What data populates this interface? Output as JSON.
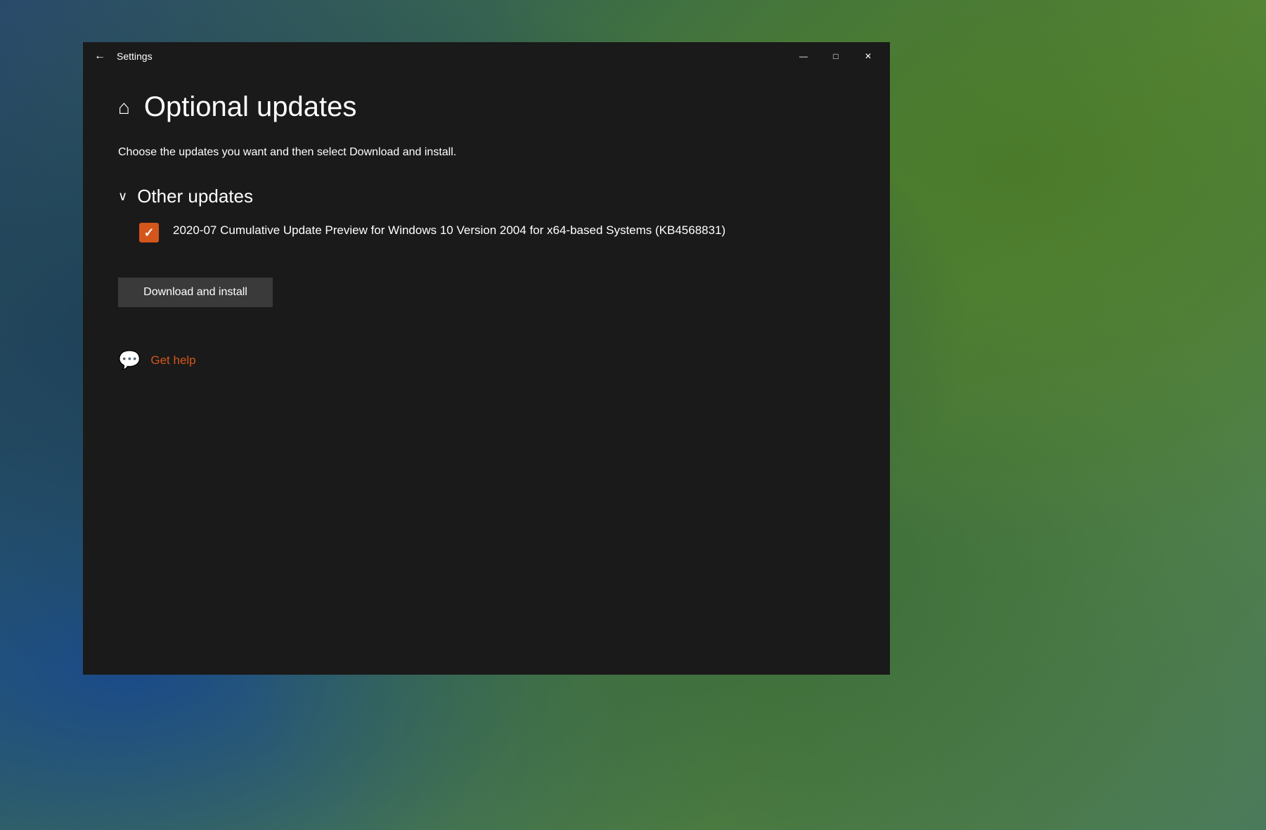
{
  "desktop": {
    "background_description": "Landscape photo with lake and greenery"
  },
  "window": {
    "title": "Settings",
    "titlebar": {
      "back_label": "←",
      "minimize_label": "—",
      "maximize_label": "□",
      "close_label": "✕"
    }
  },
  "page": {
    "home_icon": "⌂",
    "title": "Optional updates",
    "description": "Choose the updates you want and then select Download and install.",
    "section": {
      "chevron": "∨",
      "title": "Other updates",
      "update_item": {
        "checked": true,
        "text": "2020-07 Cumulative Update Preview for Windows 10 Version 2004 for x64-based Systems (KB4568831)"
      }
    },
    "download_button_label": "Download and install",
    "help": {
      "icon": "💬",
      "link_text": "Get help"
    }
  },
  "colors": {
    "accent": "#d4561a",
    "background": "#1a1a1a",
    "text": "#ffffff",
    "button_bg": "#3a3a3a",
    "checkbox_bg": "#d4561a"
  }
}
